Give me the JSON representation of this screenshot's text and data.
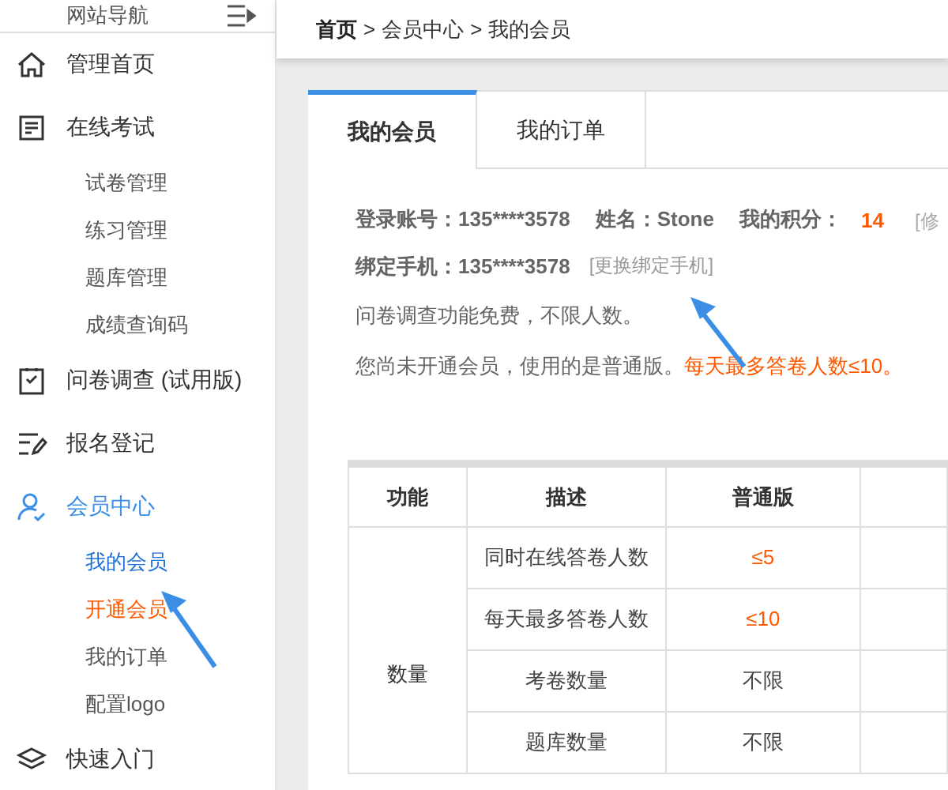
{
  "sidebar": {
    "title": "网站导航",
    "items": [
      {
        "label": "管理首页",
        "selected": false
      },
      {
        "label": "在线考试",
        "selected": false,
        "children": [
          {
            "label": "试卷管理",
            "selected": false,
            "kind": "normal"
          },
          {
            "label": "练习管理",
            "selected": false,
            "kind": "normal"
          },
          {
            "label": "题库管理",
            "selected": false,
            "kind": "normal"
          },
          {
            "label": "成绩查询码",
            "selected": false,
            "kind": "normal"
          }
        ]
      },
      {
        "label": "问卷调查 (试用版)",
        "selected": false
      },
      {
        "label": "报名登记",
        "selected": false
      },
      {
        "label": "会员中心",
        "selected": true,
        "children": [
          {
            "label": "我的会员",
            "selected": true,
            "kind": "normal"
          },
          {
            "label": "开通会员",
            "selected": false,
            "kind": "promo"
          },
          {
            "label": "我的订单",
            "selected": false,
            "kind": "normal"
          },
          {
            "label": "配置logo",
            "selected": false,
            "kind": "normal"
          }
        ]
      },
      {
        "label": "快速入门",
        "selected": false
      }
    ]
  },
  "breadcrumb": [
    "首页",
    "会员中心",
    "我的会员"
  ],
  "breadcrumb_separators": [
    ">",
    ">"
  ],
  "tabs": [
    {
      "label": "我的会员",
      "selected": true
    },
    {
      "label": "我的订单",
      "selected": false
    }
  ],
  "account": {
    "login_label": "登录账号：",
    "login_value": "135****3578",
    "name_label": "姓名：",
    "name_value": "Stone",
    "points_label": "我的积分：",
    "points_value": "14",
    "edit_link": "[修",
    "phone_label": "绑定手机：",
    "phone_value": "135****3578",
    "change_phone_link": "[更换绑定手机]"
  },
  "notes": [
    {
      "text": "问卷调查功能免费，不限人数。"
    },
    {
      "text": "您尚未开通会员，使用的是普通版。",
      "highlight": "每天最多答卷人数≤10。"
    }
  ],
  "table": {
    "columns": [
      "功能",
      "描述",
      "普通版"
    ],
    "group": "数量",
    "rows": [
      {
        "description": "同时在线答卷人数",
        "basic": "≤5",
        "highlight": true
      },
      {
        "description": "每天最多答卷人数",
        "basic": "≤10",
        "highlight": true
      },
      {
        "description": "考卷数量",
        "basic": "不限",
        "highlight": false
      },
      {
        "description": "题库数量",
        "basic": "不限",
        "highlight": false
      }
    ]
  }
}
